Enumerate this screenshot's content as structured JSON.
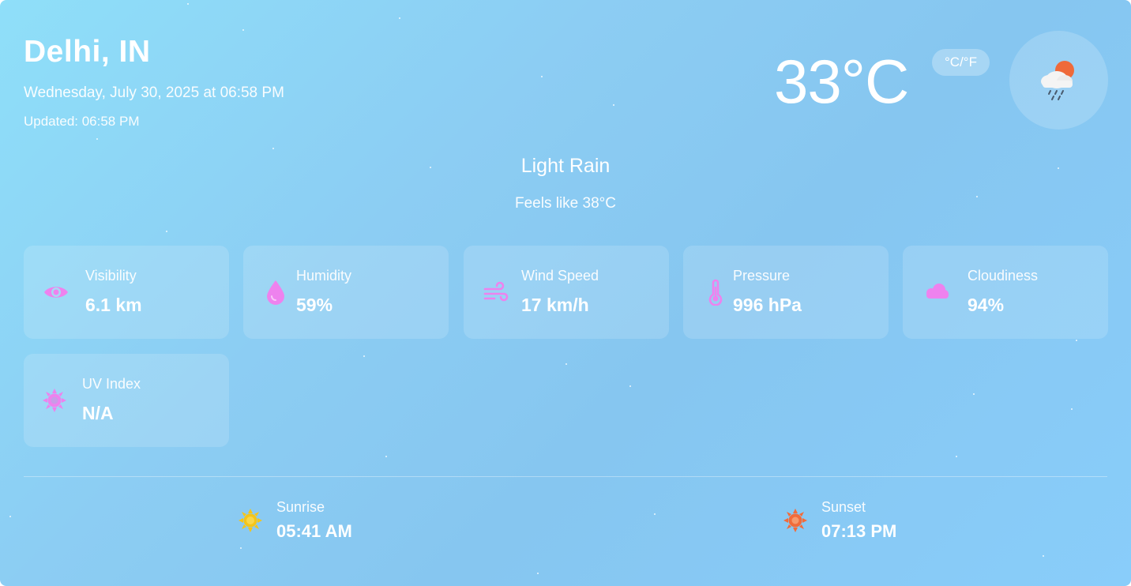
{
  "location": {
    "city": "Delhi, IN",
    "datetime": "Wednesday, July 30, 2025 at 06:58 PM",
    "updated": "Updated: 06:58 PM"
  },
  "current": {
    "temperature": "33°C",
    "unit_toggle_label": "°C/°F",
    "condition": "Light Rain",
    "feels_like": "Feels like 38°C",
    "icon": "cloud-sun-rain-icon"
  },
  "details": [
    {
      "label": "Visibility",
      "value": "6.1 km",
      "icon": "eye-icon"
    },
    {
      "label": "Humidity",
      "value": "59%",
      "icon": "droplet-icon"
    },
    {
      "label": "Wind Speed",
      "value": "17 km/h",
      "icon": "wind-icon"
    },
    {
      "label": "Pressure",
      "value": "996 hPa",
      "icon": "thermometer-icon"
    },
    {
      "label": "Cloudiness",
      "value": "94%",
      "icon": "cloud-icon"
    },
    {
      "label": "UV Index",
      "value": "N/A",
      "icon": "uv-sun-icon"
    }
  ],
  "sun": {
    "sunrise_label": "Sunrise",
    "sunrise_time": "05:41 AM",
    "sunset_label": "Sunset",
    "sunset_time": "07:13 PM"
  },
  "colors": {
    "accent_icon": "#ee82ee",
    "sunrise_icon": "#f5c518",
    "sunset_icon": "#f26b3a"
  }
}
